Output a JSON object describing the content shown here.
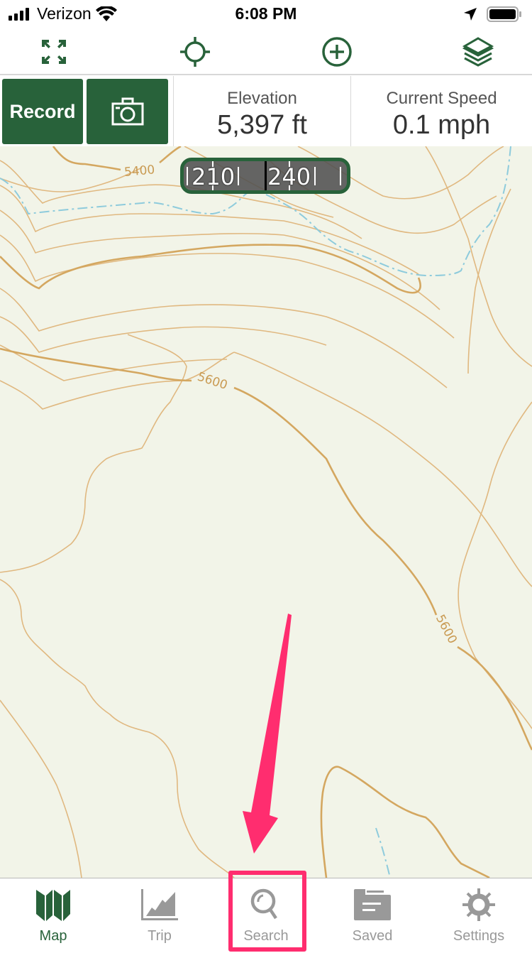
{
  "status_bar": {
    "carrier": "Verizon",
    "time": "6:08 PM",
    "icons": [
      "signal-bars-icon",
      "wifi-icon",
      "location-arrow-icon",
      "battery-icon"
    ]
  },
  "toolbar": {
    "buttons": [
      {
        "name": "expand",
        "icon": "expand-arrows-icon"
      },
      {
        "name": "locate",
        "icon": "crosshair-icon"
      },
      {
        "name": "add",
        "icon": "plus-circle-icon"
      },
      {
        "name": "layers",
        "icon": "layers-icon"
      }
    ]
  },
  "infobar": {
    "record_label": "Record",
    "camera_icon": "camera-icon",
    "elevation": {
      "label": "Elevation",
      "value": "5,397 ft"
    },
    "speed": {
      "label": "Current Speed",
      "value": "0.1 mph"
    }
  },
  "compass": {
    "left_heading": "210",
    "right_heading": "240"
  },
  "map": {
    "contour_labels": [
      "5400",
      "5600",
      "5600"
    ],
    "colors": {
      "background": "#f2f4e8",
      "contour": "#e0b880",
      "index_contour": "#d4a760",
      "stream": "#8ecbdc"
    }
  },
  "tabbar": {
    "tabs": [
      {
        "label": "Map",
        "icon": "map-icon",
        "active": true
      },
      {
        "label": "Trip",
        "icon": "trip-chart-icon",
        "active": false
      },
      {
        "label": "Search",
        "icon": "search-icon",
        "active": false
      },
      {
        "label": "Saved",
        "icon": "folder-icon",
        "active": false
      },
      {
        "label": "Settings",
        "icon": "gear-icon",
        "active": false
      }
    ]
  },
  "theme": {
    "brand_green": "#28623a",
    "inactive_gray": "#999999",
    "annotation_pink": "#ff2d6f"
  }
}
